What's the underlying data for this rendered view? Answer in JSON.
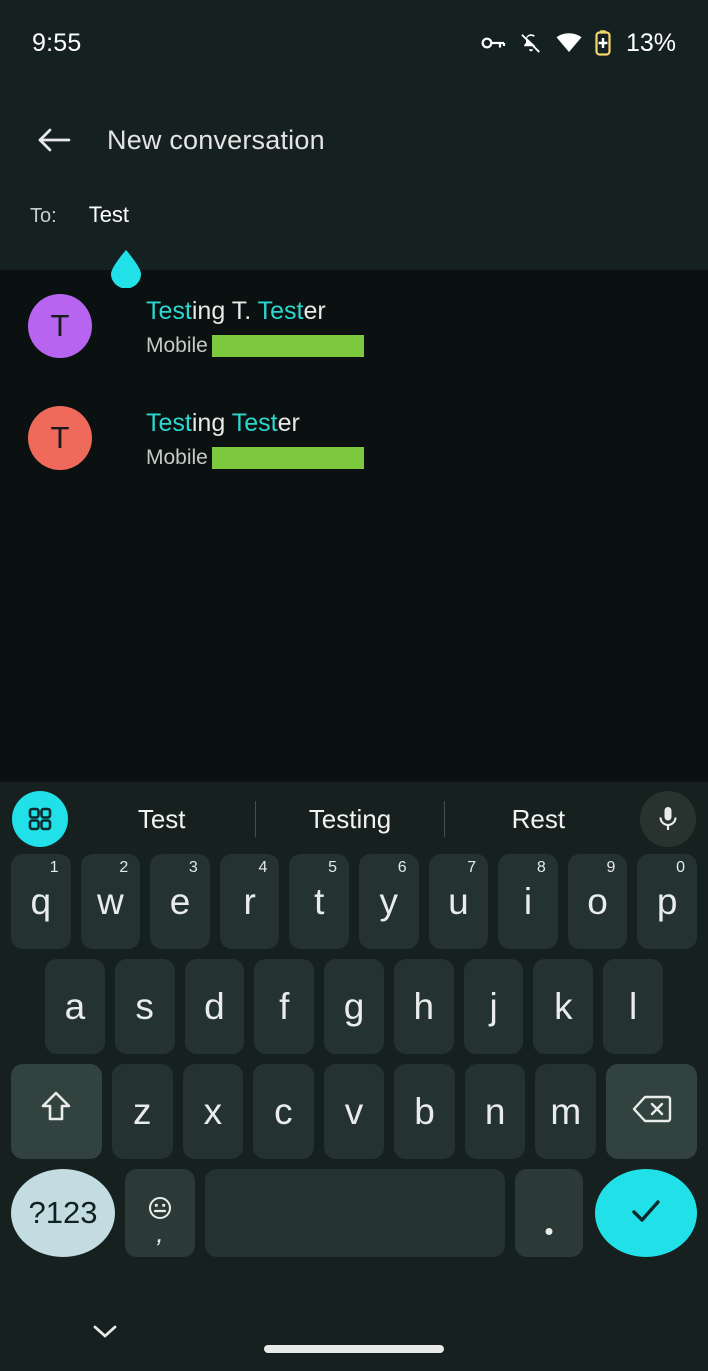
{
  "status_bar": {
    "time": "9:55",
    "battery_percent": "13%",
    "icons": [
      "key-icon",
      "notifications-muted-icon",
      "wifi-icon",
      "battery-saver-icon"
    ]
  },
  "header": {
    "back_icon": "back-arrow-icon",
    "title": "New conversation",
    "to_label": "To:",
    "to_value": "Test"
  },
  "contacts": [
    {
      "avatar_letter": "T",
      "avatar_color": "#b764f0",
      "name_parts": [
        {
          "text": "Test",
          "highlight": true
        },
        {
          "text": "ing T. ",
          "highlight": false
        },
        {
          "text": "Test",
          "highlight": true
        },
        {
          "text": "er",
          "highlight": false
        }
      ],
      "name_plain": "Testing T. Tester",
      "type_label": "Mobile",
      "number_redacted": true
    },
    {
      "avatar_letter": "T",
      "avatar_color": "#f06a5c",
      "name_parts": [
        {
          "text": "Test",
          "highlight": true
        },
        {
          "text": "ing ",
          "highlight": false
        },
        {
          "text": "Test",
          "highlight": true
        },
        {
          "text": "er",
          "highlight": false
        }
      ],
      "name_plain": "Testing Tester",
      "type_label": "Mobile",
      "number_redacted": true
    }
  ],
  "keyboard": {
    "toolbar": {
      "grid_icon": "apps-grid-icon",
      "mic_icon": "microphone-icon",
      "suggestions": [
        "Test",
        "Testing",
        "Rest"
      ]
    },
    "row1": [
      {
        "key": "q",
        "num": "1"
      },
      {
        "key": "w",
        "num": "2"
      },
      {
        "key": "e",
        "num": "3"
      },
      {
        "key": "r",
        "num": "4"
      },
      {
        "key": "t",
        "num": "5"
      },
      {
        "key": "y",
        "num": "6"
      },
      {
        "key": "u",
        "num": "7"
      },
      {
        "key": "i",
        "num": "8"
      },
      {
        "key": "o",
        "num": "9"
      },
      {
        "key": "p",
        "num": "0"
      }
    ],
    "row2": [
      "a",
      "s",
      "d",
      "f",
      "g",
      "h",
      "j",
      "k",
      "l"
    ],
    "row3": [
      "z",
      "x",
      "c",
      "v",
      "b",
      "n",
      "m"
    ],
    "shift_icon": "shift-arrow-icon",
    "backspace_icon": "backspace-icon",
    "row4": {
      "symbols_label": "?123",
      "emoji_icon": "emoji-smiley-icon",
      "comma_label": ",",
      "space_label": "",
      "period_label": ".",
      "enter_icon": "checkmark-icon"
    }
  },
  "nav_bar": {
    "hide_keyboard_icon": "chevron-down-icon",
    "home_indicator": "home-indicator-pill"
  },
  "colors": {
    "accent_cyan": "#22e0e8",
    "highlight_text": "#2dd7d0",
    "redaction_green": "#7cc93f",
    "header_bg": "#152120",
    "content_bg": "#0a1110",
    "keyboard_bg": "#16211f",
    "key_bg": "#243331",
    "mod_key_bg": "#32433f",
    "symbols_key_bg": "#c3dce2"
  }
}
